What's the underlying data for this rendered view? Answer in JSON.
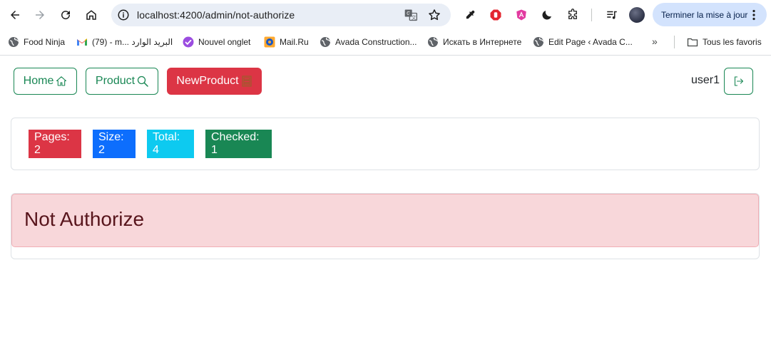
{
  "browser": {
    "url": "localhost:4200/admin/not-authorize",
    "update_button": "Terminer la mise à jour",
    "bookmarks": [
      {
        "label": "Food Ninja",
        "icon": "globe-icon"
      },
      {
        "label": "(79) - m... البريد الوارد",
        "icon": "gmail-icon"
      },
      {
        "label": "Nouvel onglet",
        "icon": "new-tab-icon"
      },
      {
        "label": "Mail.Ru",
        "icon": "mailru-icon"
      },
      {
        "label": "Avada Construction...",
        "icon": "globe-icon"
      },
      {
        "label": "Искать в Интернете",
        "icon": "globe-icon"
      },
      {
        "label": "Edit Page ‹ Avada C...",
        "icon": "globe-icon"
      }
    ],
    "more_bookmarks": "»",
    "all_bookmarks": "Tous les favoris"
  },
  "navbar": {
    "home": "Home",
    "product": "Product",
    "new_product": "NewProduct",
    "user": "user1"
  },
  "stats": {
    "pages": "Pages: 2",
    "size": "Size: 2",
    "total": "Total: 4",
    "checked": "Checked: 1"
  },
  "alert": {
    "message": "Not Authorize"
  },
  "colors": {
    "success": "#198754",
    "danger": "#dc3545",
    "primary": "#0d6efd",
    "info": "#0dcaf0",
    "alert_bg": "#f8d7da",
    "alert_text": "#58151c"
  }
}
